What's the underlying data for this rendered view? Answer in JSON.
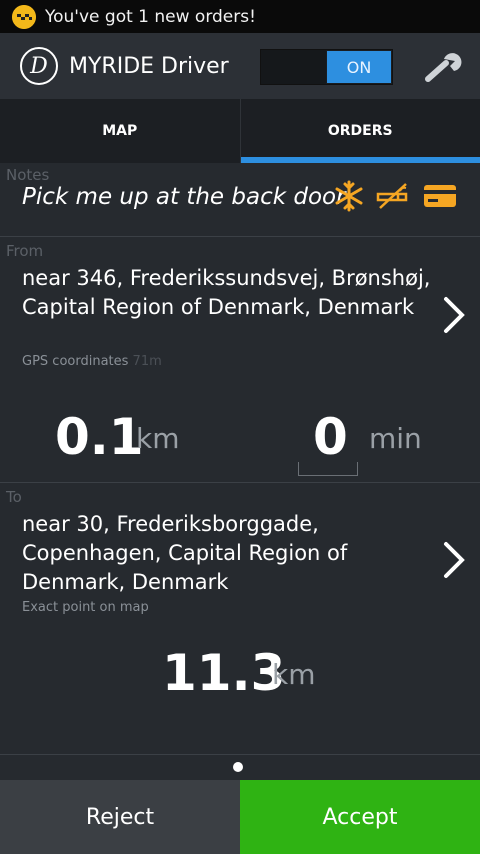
{
  "status_bar": {
    "notification_icon": "taxi-checker-icon",
    "notification_text": "You've got 1 new orders!"
  },
  "action_bar": {
    "logo_letter": "D",
    "app_title": "MYRIDE Driver",
    "toggle_label": "ON",
    "settings_icon": "wrench-icon"
  },
  "tabs": [
    {
      "label": "MAP",
      "active": false
    },
    {
      "label": "ORDERS",
      "active": true
    }
  ],
  "order": {
    "notes": {
      "label": "Notes",
      "text": "Pick me up at the back door",
      "icons": [
        "snowflake-icon",
        "no-smoking-icon",
        "credit-card-icon"
      ]
    },
    "from": {
      "label": "From",
      "address": "near 346, Frederikssundsvej, Brønshøj, Capital Region of Denmark, Denmark",
      "source": "GPS coordinates",
      "accuracy": "71m",
      "distance_value": "0.1",
      "distance_unit": "km",
      "time_value": "0",
      "time_unit": "min"
    },
    "to": {
      "label": "To",
      "address": "near 30, Frederiksborggade, Copenhagen, Capital Region of Denmark, Denmark",
      "source": "Exact point on map",
      "distance_value": "11.3",
      "distance_unit": "km"
    }
  },
  "buttons": {
    "reject_label": "Reject",
    "accept_label": "Accept"
  },
  "colors": {
    "accent_blue": "#2d8fe0",
    "accept_green": "#2fb313",
    "icon_orange": "#f5a623"
  }
}
